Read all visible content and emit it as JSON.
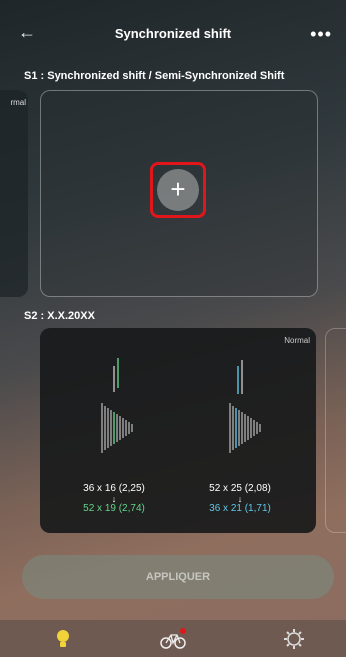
{
  "header": {
    "title": "Synchronized shift",
    "back_icon": "arrow-left-icon",
    "more_icon": "more-dots-icon"
  },
  "sections": {
    "s1_label": "S1 : Synchronized shift / Semi-Synchronized Shift",
    "s1_peek_label": "rmal",
    "s2_label": "S2 : X.X.20XX",
    "s2_card_label": "Normal"
  },
  "gears": {
    "left": {
      "from": "36 x 16 (2,25)",
      "arrow": "↓",
      "to": "52 x 19 (2,74)"
    },
    "right": {
      "from": "52 x 25 (2,08)",
      "arrow": "↓",
      "to": "36 x 21 (1,71)"
    }
  },
  "apply_label": "APPLIQUER",
  "tabs": [
    "bulb-icon",
    "bike-icon",
    "gear-icon"
  ],
  "colors": {
    "accent_red": "#e0161b",
    "green": "#63d48a",
    "blue": "#5fc8e6",
    "tab_active": "#f2d43a"
  }
}
